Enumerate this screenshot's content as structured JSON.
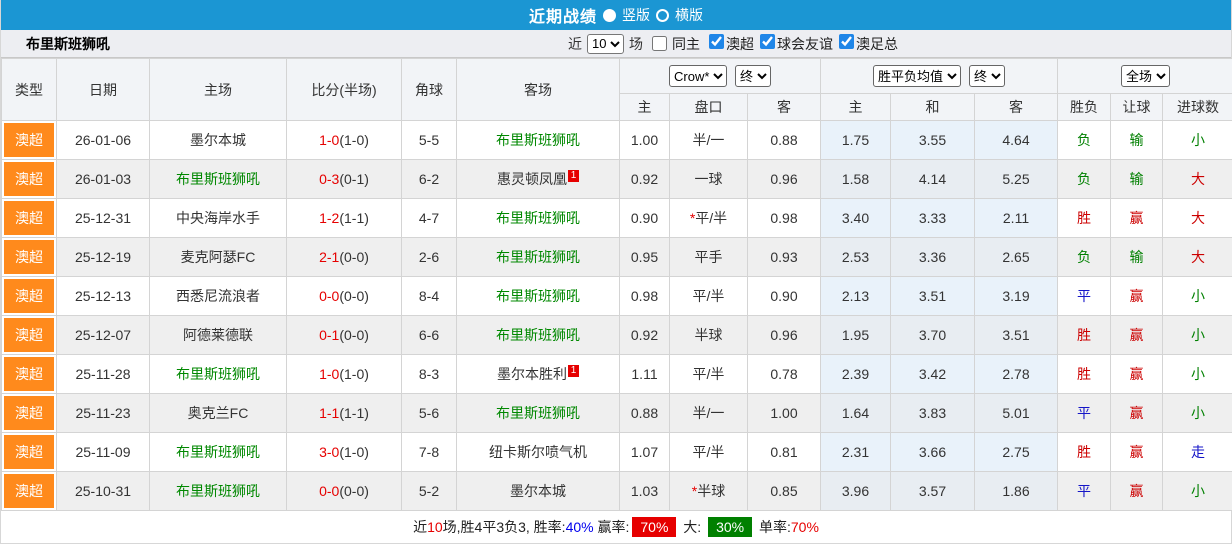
{
  "colors": {
    "accent_blue": "#1b96d3",
    "league_orange": "#ff8a1c",
    "team_green": "#008800",
    "score_red": "#e60000",
    "result_red": "#cc0000",
    "result_green": "#008000",
    "result_blue": "#1515c8"
  },
  "title_bar": {
    "title": "近期战绩",
    "layout_options": [
      {
        "label": "竖版",
        "selected": true
      },
      {
        "label": "横版",
        "selected": false
      }
    ]
  },
  "filter_bar": {
    "team_name": "布里斯班狮吼",
    "recent_label": "近",
    "recent_count": "10",
    "matches_label": "场",
    "same_home": {
      "label": "同主",
      "checked": false
    },
    "competitions": [
      {
        "label": "澳超",
        "checked": true
      },
      {
        "label": "球会友谊",
        "checked": true
      },
      {
        "label": "澳足总",
        "checked": true
      }
    ]
  },
  "table": {
    "columns": [
      "类型",
      "日期",
      "主场",
      "比分(半场)",
      "角球",
      "客场"
    ],
    "dropdowns": {
      "bookmaker": "Crow*",
      "bookmaker_time": "终",
      "mean": "胜平负均值",
      "mean_time": "终",
      "scope": "全场"
    },
    "sub_columns": [
      "主",
      "盘口",
      "客",
      "主",
      "和",
      "客",
      "胜负",
      "让球",
      "进球数"
    ],
    "rows": [
      {
        "league": "澳超",
        "date": "26-01-06",
        "home": {
          "name": "墨尔本城",
          "green": false,
          "badge": null
        },
        "score": {
          "ft": "1-0",
          "ht": "(1-0)"
        },
        "corner": "5-5",
        "away": {
          "name": "布里斯班狮吼",
          "green": true,
          "badge": null
        },
        "crow": {
          "home": "1.00",
          "handicap": "半/一",
          "star": false,
          "away": "0.88"
        },
        "mean": {
          "home": "1.75",
          "draw": "3.55",
          "away": "4.64"
        },
        "outcome": {
          "result": {
            "text": "负",
            "color": "green"
          },
          "handicap": {
            "text": "输",
            "color": "green"
          },
          "goals": {
            "text": "小",
            "color": "green"
          }
        }
      },
      {
        "league": "澳超",
        "date": "26-01-03",
        "home": {
          "name": "布里斯班狮吼",
          "green": true,
          "badge": null
        },
        "score": {
          "ft": "0-3",
          "ht": "(0-1)"
        },
        "corner": "6-2",
        "away": {
          "name": "惠灵顿凤凰",
          "green": false,
          "badge": "1"
        },
        "crow": {
          "home": "0.92",
          "handicap": "一球",
          "star": false,
          "away": "0.96"
        },
        "mean": {
          "home": "1.58",
          "draw": "4.14",
          "away": "5.25"
        },
        "outcome": {
          "result": {
            "text": "负",
            "color": "green"
          },
          "handicap": {
            "text": "输",
            "color": "green"
          },
          "goals": {
            "text": "大",
            "color": "red"
          }
        }
      },
      {
        "league": "澳超",
        "date": "25-12-31",
        "home": {
          "name": "中央海岸水手",
          "green": false,
          "badge": null
        },
        "score": {
          "ft": "1-2",
          "ht": "(1-1)"
        },
        "corner": "4-7",
        "away": {
          "name": "布里斯班狮吼",
          "green": true,
          "badge": null
        },
        "crow": {
          "home": "0.90",
          "handicap": "平/半",
          "star": true,
          "away": "0.98"
        },
        "mean": {
          "home": "3.40",
          "draw": "3.33",
          "away": "2.11"
        },
        "outcome": {
          "result": {
            "text": "胜",
            "color": "red"
          },
          "handicap": {
            "text": "赢",
            "color": "red"
          },
          "goals": {
            "text": "大",
            "color": "red"
          }
        }
      },
      {
        "league": "澳超",
        "date": "25-12-19",
        "home": {
          "name": "麦克阿瑟FC",
          "green": false,
          "badge": null
        },
        "score": {
          "ft": "2-1",
          "ht": "(0-0)"
        },
        "corner": "2-6",
        "away": {
          "name": "布里斯班狮吼",
          "green": true,
          "badge": null
        },
        "crow": {
          "home": "0.95",
          "handicap": "平手",
          "star": false,
          "away": "0.93"
        },
        "mean": {
          "home": "2.53",
          "draw": "3.36",
          "away": "2.65"
        },
        "outcome": {
          "result": {
            "text": "负",
            "color": "green"
          },
          "handicap": {
            "text": "输",
            "color": "green"
          },
          "goals": {
            "text": "大",
            "color": "red"
          }
        }
      },
      {
        "league": "澳超",
        "date": "25-12-13",
        "home": {
          "name": "西悉尼流浪者",
          "green": false,
          "badge": null
        },
        "score": {
          "ft": "0-0",
          "ht": "(0-0)"
        },
        "corner": "8-4",
        "away": {
          "name": "布里斯班狮吼",
          "green": true,
          "badge": null
        },
        "crow": {
          "home": "0.98",
          "handicap": "平/半",
          "star": false,
          "away": "0.90"
        },
        "mean": {
          "home": "2.13",
          "draw": "3.51",
          "away": "3.19"
        },
        "outcome": {
          "result": {
            "text": "平",
            "color": "blue"
          },
          "handicap": {
            "text": "赢",
            "color": "red"
          },
          "goals": {
            "text": "小",
            "color": "green"
          }
        }
      },
      {
        "league": "澳超",
        "date": "25-12-07",
        "home": {
          "name": "阿德莱德联",
          "green": false,
          "badge": null
        },
        "score": {
          "ft": "0-1",
          "ht": "(0-0)"
        },
        "corner": "6-6",
        "away": {
          "name": "布里斯班狮吼",
          "green": true,
          "badge": null
        },
        "crow": {
          "home": "0.92",
          "handicap": "半球",
          "star": false,
          "away": "0.96"
        },
        "mean": {
          "home": "1.95",
          "draw": "3.70",
          "away": "3.51"
        },
        "outcome": {
          "result": {
            "text": "胜",
            "color": "red"
          },
          "handicap": {
            "text": "赢",
            "color": "red"
          },
          "goals": {
            "text": "小",
            "color": "green"
          }
        }
      },
      {
        "league": "澳超",
        "date": "25-11-28",
        "home": {
          "name": "布里斯班狮吼",
          "green": true,
          "badge": null
        },
        "score": {
          "ft": "1-0",
          "ht": "(1-0)"
        },
        "corner": "8-3",
        "away": {
          "name": "墨尔本胜利",
          "green": false,
          "badge": "1"
        },
        "crow": {
          "home": "1.11",
          "handicap": "平/半",
          "star": false,
          "away": "0.78"
        },
        "mean": {
          "home": "2.39",
          "draw": "3.42",
          "away": "2.78"
        },
        "outcome": {
          "result": {
            "text": "胜",
            "color": "red"
          },
          "handicap": {
            "text": "赢",
            "color": "red"
          },
          "goals": {
            "text": "小",
            "color": "green"
          }
        }
      },
      {
        "league": "澳超",
        "date": "25-11-23",
        "home": {
          "name": "奥克兰FC",
          "green": false,
          "badge": null
        },
        "score": {
          "ft": "1-1",
          "ht": "(1-1)"
        },
        "corner": "5-6",
        "away": {
          "name": "布里斯班狮吼",
          "green": true,
          "badge": null
        },
        "crow": {
          "home": "0.88",
          "handicap": "半/一",
          "star": false,
          "away": "1.00"
        },
        "mean": {
          "home": "1.64",
          "draw": "3.83",
          "away": "5.01"
        },
        "outcome": {
          "result": {
            "text": "平",
            "color": "blue"
          },
          "handicap": {
            "text": "赢",
            "color": "red"
          },
          "goals": {
            "text": "小",
            "color": "green"
          }
        }
      },
      {
        "league": "澳超",
        "date": "25-11-09",
        "home": {
          "name": "布里斯班狮吼",
          "green": true,
          "badge": null
        },
        "score": {
          "ft": "3-0",
          "ht": "(1-0)"
        },
        "corner": "7-8",
        "away": {
          "name": "纽卡斯尔喷气机",
          "green": false,
          "badge": null
        },
        "crow": {
          "home": "1.07",
          "handicap": "平/半",
          "star": false,
          "away": "0.81"
        },
        "mean": {
          "home": "2.31",
          "draw": "3.66",
          "away": "2.75"
        },
        "outcome": {
          "result": {
            "text": "胜",
            "color": "red"
          },
          "handicap": {
            "text": "赢",
            "color": "red"
          },
          "goals": {
            "text": "走",
            "color": "blue"
          }
        }
      },
      {
        "league": "澳超",
        "date": "25-10-31",
        "home": {
          "name": "布里斯班狮吼",
          "green": true,
          "badge": null
        },
        "score": {
          "ft": "0-0",
          "ht": "(0-0)"
        },
        "corner": "5-2",
        "away": {
          "name": "墨尔本城",
          "green": false,
          "badge": null
        },
        "crow": {
          "home": "1.03",
          "handicap": "半球",
          "star": true,
          "away": "0.85"
        },
        "mean": {
          "home": "3.96",
          "draw": "3.57",
          "away": "1.86"
        },
        "outcome": {
          "result": {
            "text": "平",
            "color": "blue"
          },
          "handicap": {
            "text": "赢",
            "color": "red"
          },
          "goals": {
            "text": "小",
            "color": "green"
          }
        }
      }
    ]
  },
  "footer": {
    "segments": [
      {
        "text": "近",
        "style": "plain"
      },
      {
        "text": "10",
        "style": "red"
      },
      {
        "text": "场,胜4平3负3, 胜率:",
        "style": "plain"
      },
      {
        "text": "40%",
        "style": "blue"
      },
      {
        "text": " 赢率:",
        "style": "plain"
      },
      {
        "text": "70%",
        "style": "badge-red"
      },
      {
        "text": " 大: ",
        "style": "plain"
      },
      {
        "text": "30%",
        "style": "badge-green"
      },
      {
        "text": " 单率:",
        "style": "plain"
      },
      {
        "text": "70%",
        "style": "red"
      }
    ]
  }
}
